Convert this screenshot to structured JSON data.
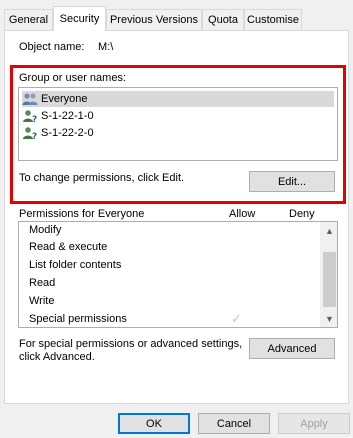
{
  "tabs": [
    {
      "label": "General"
    },
    {
      "label": "Security"
    },
    {
      "label": "Previous Versions"
    },
    {
      "label": "Quota"
    },
    {
      "label": "Customise"
    }
  ],
  "object": {
    "label": "Object name:",
    "value": "M:\\"
  },
  "group": {
    "label": "Group or user names:",
    "users": [
      {
        "name": "Everyone",
        "icon": "users-group-icon"
      },
      {
        "name": "S-1-22-1-0",
        "icon": "unknown-user-icon"
      },
      {
        "name": "S-1-22-2-0",
        "icon": "unknown-user-icon"
      }
    ],
    "change_text": "To change permissions, click Edit.",
    "edit_label": "Edit..."
  },
  "permissions": {
    "title": "Permissions for Everyone",
    "allow_label": "Allow",
    "deny_label": "Deny",
    "items": [
      {
        "name": "Modify",
        "allow": false,
        "deny": false
      },
      {
        "name": "Read & execute",
        "allow": false,
        "deny": false
      },
      {
        "name": "List folder contents",
        "allow": false,
        "deny": false
      },
      {
        "name": "Read",
        "allow": false,
        "deny": false
      },
      {
        "name": "Write",
        "allow": false,
        "deny": false
      },
      {
        "name": "Special permissions",
        "allow": true,
        "deny": false
      }
    ]
  },
  "advanced": {
    "text_line1": "For special permissions or advanced settings,",
    "text_line2": "click Advanced.",
    "button_label": "Advanced"
  },
  "footer": {
    "ok_label": "OK",
    "cancel_label": "Cancel",
    "apply_label": "Apply"
  },
  "colors": {
    "highlight": "#e20000",
    "default_button_border": "#0078d7"
  }
}
